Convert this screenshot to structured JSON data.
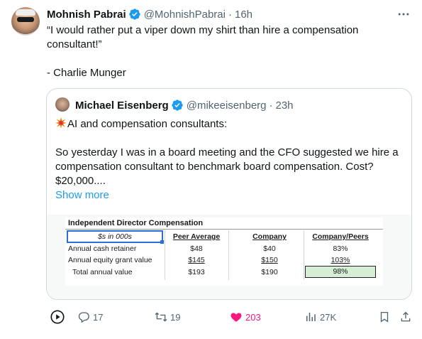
{
  "tweet": {
    "author_name": "Mohnish Pabrai",
    "handle": "@MohnishPabrai",
    "separator": "·",
    "time": "16h",
    "text_line1": "“I would rather put a viper down my shirt than hire a compensation consultant!”",
    "text_line2": "- Charlie Munger"
  },
  "quote": {
    "author_name": "Michael Eisenberg",
    "handle": "@mikeeisenberg",
    "separator": "·",
    "time": "23h",
    "text_line1": "AI and compensation consultants:",
    "text_line2": "So yesterday I was in a board meeting and the CFO suggested we hire a compensation consultant to benchmark board compensation. Cost? $20,000....",
    "show_more": "Show more",
    "image": {
      "title": "Independent Director Compensation",
      "unit_label": "$s in 000s",
      "headers": [
        "Peer Average",
        "Company",
        "Company/Peers"
      ],
      "rows": [
        {
          "label": "Annual cash retainer",
          "peer": "$48",
          "company": "$40",
          "ratio": "83%"
        },
        {
          "label": "Annual equity grant value",
          "peer": "$145",
          "company": "$150",
          "ratio": "103%"
        },
        {
          "label": "Total annual value",
          "peer": "$193",
          "company": "$190",
          "ratio": "98%"
        }
      ]
    }
  },
  "actions": {
    "replies": "17",
    "retweets": "19",
    "likes": "203",
    "views": "27K"
  },
  "colors": {
    "accent": "#1d9bf0",
    "like": "#f91880",
    "muted": "#536471",
    "border": "#cfd9de"
  },
  "icons": [
    "verified-badge-icon",
    "more-icon",
    "collision-emoji-icon",
    "play-icon",
    "reply-icon",
    "retweet-icon",
    "like-icon",
    "views-icon",
    "bookmark-icon",
    "share-icon"
  ]
}
